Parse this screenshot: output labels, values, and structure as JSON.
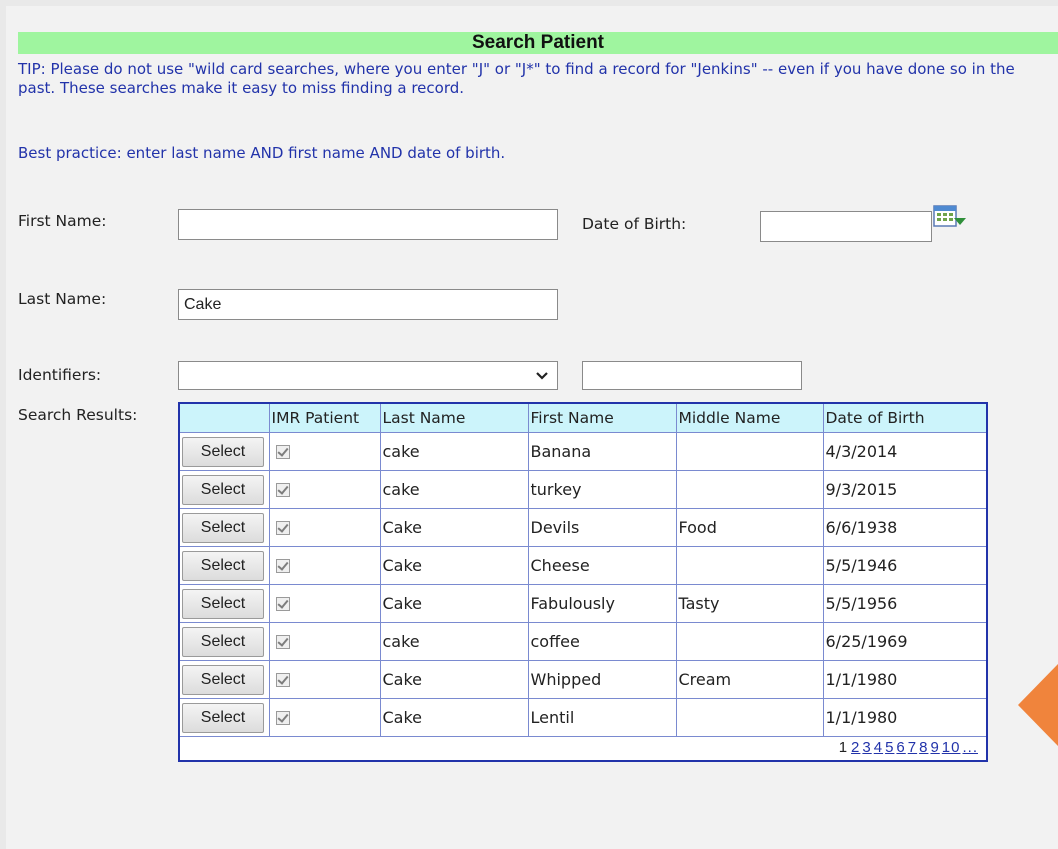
{
  "title": "Search Patient",
  "tip": "TIP: Please do not use \"wild card searches, where you enter \"J\" or \"J*\" to find a record for \"Jenkins\" -- even if you have done so in the past. These searches make it easy to miss finding a record.",
  "best_practice": "Best practice: enter last name AND first name AND date of birth.",
  "form": {
    "first_name_label": "First Name:",
    "first_name_value": "",
    "dob_label": "Date of Birth:",
    "dob_value": "",
    "last_name_label": "Last Name:",
    "last_name_value": "Cake",
    "identifiers_label": "Identifiers:",
    "identifiers_selected": "",
    "identifier_value": "",
    "search_results_label": "Search Results:"
  },
  "results": {
    "columns": [
      "",
      "IMR Patient",
      "Last Name",
      "First Name",
      "Middle Name",
      "Date of Birth"
    ],
    "select_label": "Select",
    "rows": [
      {
        "imr": true,
        "last": "cake",
        "first": "Banana",
        "middle": "",
        "dob": "4/3/2014"
      },
      {
        "imr": true,
        "last": "cake",
        "first": "turkey",
        "middle": "",
        "dob": "9/3/2015"
      },
      {
        "imr": true,
        "last": "Cake",
        "first": "Devils",
        "middle": "Food",
        "dob": "6/6/1938"
      },
      {
        "imr": true,
        "last": "Cake",
        "first": "Cheese",
        "middle": "",
        "dob": "5/5/1946"
      },
      {
        "imr": true,
        "last": "Cake",
        "first": "Fabulously",
        "middle": "Tasty",
        "dob": "5/5/1956"
      },
      {
        "imr": true,
        "last": "cake",
        "first": "coffee",
        "middle": "",
        "dob": "6/25/1969"
      },
      {
        "imr": true,
        "last": "Cake",
        "first": "Whipped",
        "middle": "Cream",
        "dob": "1/1/1980"
      },
      {
        "imr": true,
        "last": "Cake",
        "first": "Lentil",
        "middle": "",
        "dob": "1/1/1980"
      }
    ],
    "pager": {
      "current": "1",
      "pages": [
        "2",
        "3",
        "4",
        "5",
        "6",
        "7",
        "8",
        "9",
        "10",
        "..."
      ]
    }
  },
  "icons": {
    "calendar": "calendar-icon",
    "dropdown": "chevron-down-icon",
    "arrow": "arrow-left-icon"
  },
  "colors": {
    "title_bar": "#9ff59f",
    "tip_text": "#2233aa",
    "table_border": "#2233aa",
    "header_bg": "#ccf4fb",
    "arrow": "#f0843c"
  }
}
